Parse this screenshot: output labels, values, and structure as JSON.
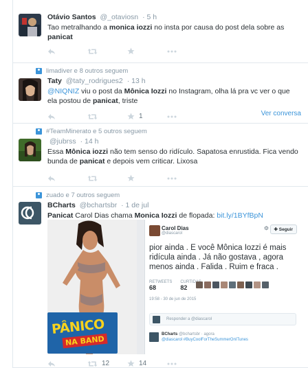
{
  "tweets": [
    {
      "name": "Otávio Santos",
      "handle": "@_otaviosn",
      "time": "5 h",
      "text_before": "Tao metralhando a ",
      "text_hl1": "monica iozzi",
      "text_mid": " no insta por causa do post dela sobre as ",
      "text_hl2": "panicat",
      "text_after": ""
    },
    {
      "context": "limadiver e 8 outros seguem",
      "name": "Taty",
      "handle": "@taty_rodrigues2",
      "time": "13 h",
      "mention": "@NIQNIZ",
      "text_a": " viu o post da ",
      "text_hl1": "Mônica Iozzi",
      "text_b": " no Instagram, olha lá pra vc ver o que ela postou de ",
      "text_hl2": "panicat",
      "text_c": ", triste",
      "fav_count": "1",
      "view_conversation": "Ver conversa"
    },
    {
      "context": "#TeamMinerato e 5 outros seguem",
      "name": "",
      "handle": "@jubrss",
      "time": "14 h",
      "text_a": "Essa ",
      "text_hl1": "Mônica iozzi",
      "text_b": " não tem senso do ridículo. Sapatosa enrustida. Fica vendo bunda de ",
      "text_hl2": "panicat",
      "text_c": " e depois vem criticar. Lixosa"
    },
    {
      "context": "zuado e 7 outros seguem",
      "name": "BCharts",
      "handle": "@bchartsbr",
      "time": "1 de jul",
      "text_hl1": "Panicat",
      "text_a": " Carol Dias chama ",
      "text_hl2": "Monica Iozzi",
      "text_b": " de flopada: ",
      "link": "bit.ly/1BYfBpN",
      "rt_count": "12",
      "fav_count": "14",
      "media": {
        "logo_top": "PÂNICO",
        "logo_bottom": "NA BAND",
        "shot_name": "Carol Dias",
        "shot_handle": "@diascarol",
        "shot_follow": "Seguir",
        "shot_text": "pior ainda . E você Mônica Iozzi é mais ridícula ainda . Já não gostava , agora menos ainda . Falida . Ruim e fraca .",
        "shot_rt_label": "RETWEETS",
        "shot_rt": "68",
        "shot_fav_label": "CURTIDAS",
        "shot_fav": "82",
        "shot_date": "19:58 - 30 de jun de 2015",
        "shot_reply": "Responder a @diascarol",
        "shot_rname": "BCharts",
        "shot_rhandle": "@bchartsbr · agora",
        "shot_rtext": "@diascarol #BuyCoolForTheSummerOnITunes"
      }
    }
  ],
  "colors": {
    "link": "#3b94d9",
    "muted": "#8899a6",
    "border": "#e1e8ed"
  }
}
